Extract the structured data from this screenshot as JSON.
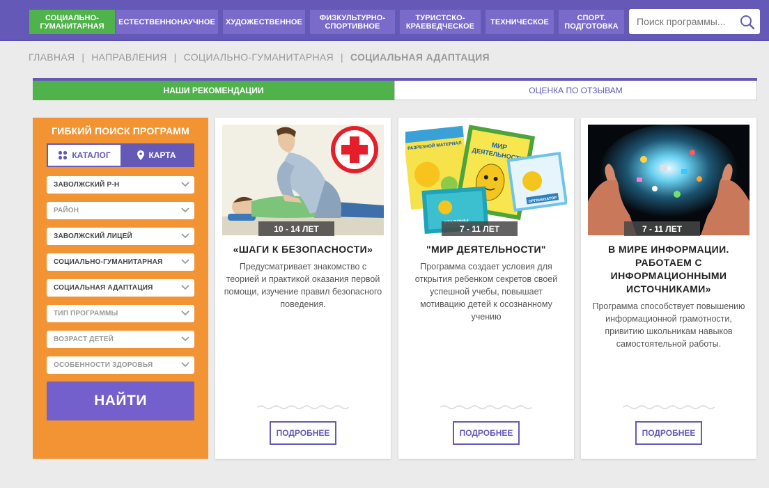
{
  "nav": {
    "items": [
      {
        "label": "СОЦИАЛЬНО-\nГУМАНИТАРНАЯ",
        "active": true
      },
      {
        "label": "ЕСТЕСТВЕННОНАУЧНОЕ",
        "active": false
      },
      {
        "label": "ХУДОЖЕСТВЕННОЕ",
        "active": false
      },
      {
        "label": "ФИЗКУЛЬТУРНО-\nСПОРТИВНОЕ",
        "active": false
      },
      {
        "label": "ТУРИСТСКО-\nКРАЕВЕДЧЕСКОЕ",
        "active": false
      },
      {
        "label": "ТЕХНИЧЕСКОЕ",
        "active": false
      },
      {
        "label": "СПОРТ.\nПОДГОТОВКА",
        "active": false
      }
    ],
    "search_placeholder": "Поиск программы..."
  },
  "breadcrumb": {
    "items": [
      "ГЛАВНАЯ",
      "НАПРАВЛЕНИЯ",
      "СОЦИАЛЬНО-ГУМАНИТАРНАЯ"
    ],
    "current": "СОЦИАЛЬНАЯ АДАПТАЦИЯ",
    "separator": "|"
  },
  "tabs": {
    "recommend": "НАШИ РЕКОМЕНДАЦИИ",
    "reviews": "ОЦЕНКА ПО ОТЗЫВАМ"
  },
  "filter": {
    "title": "ГИБКИЙ ПОИСК ПРОГРАММ",
    "catalog": "КАТАЛОГ",
    "map": "КАРТА",
    "selects": [
      {
        "value": "ЗАВОЛЖСКИЙ Р-Н",
        "placeholder": false
      },
      {
        "value": "РАЙОН",
        "placeholder": true
      },
      {
        "value": "ЗАВОЛЖСКИЙ ЛИЦЕЙ",
        "placeholder": false
      },
      {
        "value": "СОЦИАЛЬНО-ГУМАНИТАРНАЯ",
        "placeholder": false
      },
      {
        "value": "СОЦИАЛЬНАЯ АДАПТАЦИЯ",
        "placeholder": false
      },
      {
        "value": "ТИП ПРОГРАММЫ",
        "placeholder": true
      },
      {
        "value": "ВОЗРАСТ ДЕТЕЙ",
        "placeholder": true
      },
      {
        "value": "ОСОБЕННОСТИ ЗДОРОВЬЯ",
        "placeholder": true
      }
    ],
    "find_label": "НАЙТИ"
  },
  "cards": [
    {
      "age": "10 - 14 ЛЕТ",
      "title": "«ШАГИ К БЕЗОПАСНОСТИ»",
      "description": "Предусматривает знакомство с теорией и практикой оказания первой помощи, изучение правил безопасного поведения.",
      "more": "ПОДРОБНЕЕ"
    },
    {
      "age": "7 - 11 ЛЕТ",
      "title": "\"МИР ДЕЯТЕЛЬНОСТИ\"",
      "description": "Программа создает условия для открытия ребенком секретов своей успешной учебы, повышает мотивацию детей к осознанному учению",
      "more": "ПОДРОБНЕЕ"
    },
    {
      "age": "7 - 11 ЛЕТ",
      "title": "В МИРЕ ИНФОРМАЦИИ. РАБОТАЕМ С ИНФОРМАЦИОННЫМИ ИСТОЧНИКАМИ»",
      "description": "Программа способствует повышению информационной грамотности, привитию школьникам навыков самостоятельной работы.",
      "more": "ПОДРОБНЕЕ"
    }
  ],
  "book_covers": {
    "cover1": "РАЗРЕЗНОЙ МАТЕРИАЛ",
    "cover2_line1": "МИР",
    "cover2_line2": "ДЕЯТЕЛЬНОСТИ",
    "cover3": "ЭТАЛОНЫ",
    "cover4": "ОРГАНИЗАТОР"
  },
  "colors": {
    "brand": "#6559b8",
    "active_green": "#4fb24a",
    "filter_orange": "#f29433",
    "button_purple": "#7360cc"
  }
}
